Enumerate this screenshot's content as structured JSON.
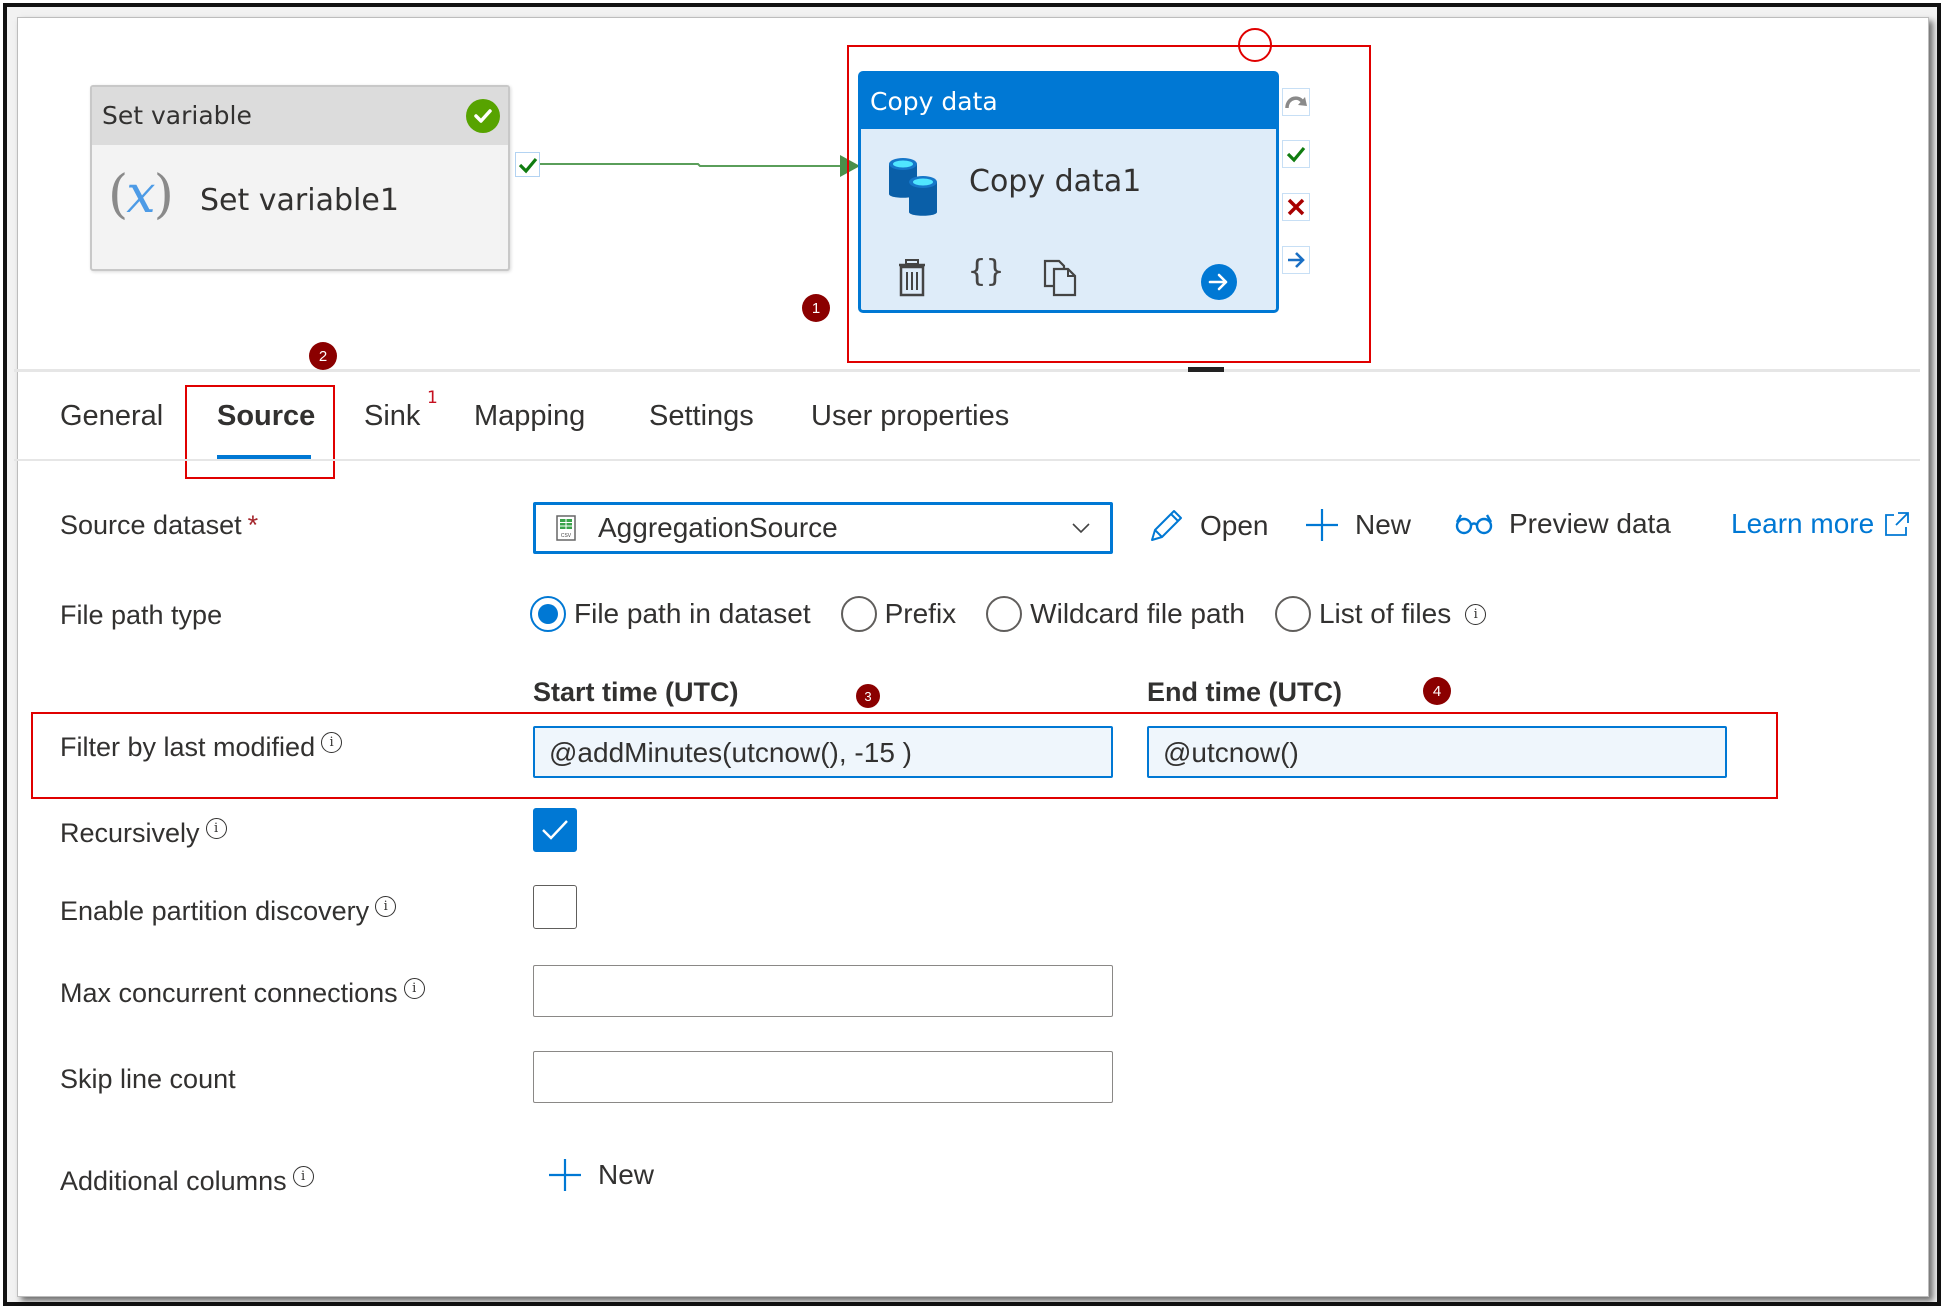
{
  "canvas": {
    "set_variable_node": {
      "type_label": "Set variable",
      "name": "Set variable1",
      "icon": "variable-x-icon",
      "status": "succeeded"
    },
    "copy_data_node": {
      "type_label": "Copy data",
      "name": "Copy data1",
      "icon": "database-copy-icon",
      "toolbar": [
        "delete-icon",
        "code-icon",
        "clone-icon",
        "open-arrow-icon"
      ],
      "output_ports": [
        "skip-icon",
        "success-check-icon",
        "failure-x-icon",
        "completion-arrow-icon"
      ],
      "selected": true
    },
    "connector": {
      "from": "Set variable1",
      "to": "Copy data1",
      "condition": "success"
    }
  },
  "annotations": {
    "badges": [
      "1",
      "2",
      "3",
      "4"
    ],
    "color": "#8b0000",
    "highlight_color": "#e00000"
  },
  "tabs": [
    {
      "label": "General",
      "active": false
    },
    {
      "label": "Source",
      "active": true
    },
    {
      "label": "Sink",
      "active": false,
      "badge": "1"
    },
    {
      "label": "Mapping",
      "active": false
    },
    {
      "label": "Settings",
      "active": false
    },
    {
      "label": "User properties",
      "active": false
    }
  ],
  "source": {
    "dataset": {
      "label": "Source dataset",
      "required_mark": "*",
      "value": "AggregationSource",
      "icon": "csv-file-icon"
    },
    "actions": {
      "open": "Open",
      "new": "New",
      "preview": "Preview data",
      "learn_more": "Learn more"
    },
    "file_path_type": {
      "label": "File path type",
      "options": [
        "File path in dataset",
        "Prefix",
        "Wildcard file path",
        "List of files"
      ],
      "selected": "File path in dataset"
    },
    "time_headers": {
      "start": "Start time (UTC)",
      "end": "End time (UTC)"
    },
    "filter_last_modified": {
      "label": "Filter by last modified",
      "start": "@addMinutes(utcnow(), -15 )",
      "end": "@utcnow()"
    },
    "recursively": {
      "label": "Recursively",
      "checked": true
    },
    "partition_discovery": {
      "label": "Enable partition discovery",
      "checked": false
    },
    "max_connections": {
      "label": "Max concurrent connections",
      "value": ""
    },
    "skip_line_count": {
      "label": "Skip line count",
      "value": ""
    },
    "additional_columns": {
      "label": "Additional columns",
      "new_label": "New"
    }
  },
  "colors": {
    "accent": "#0078d4",
    "success": "#57a300",
    "failure": "#a80000"
  }
}
